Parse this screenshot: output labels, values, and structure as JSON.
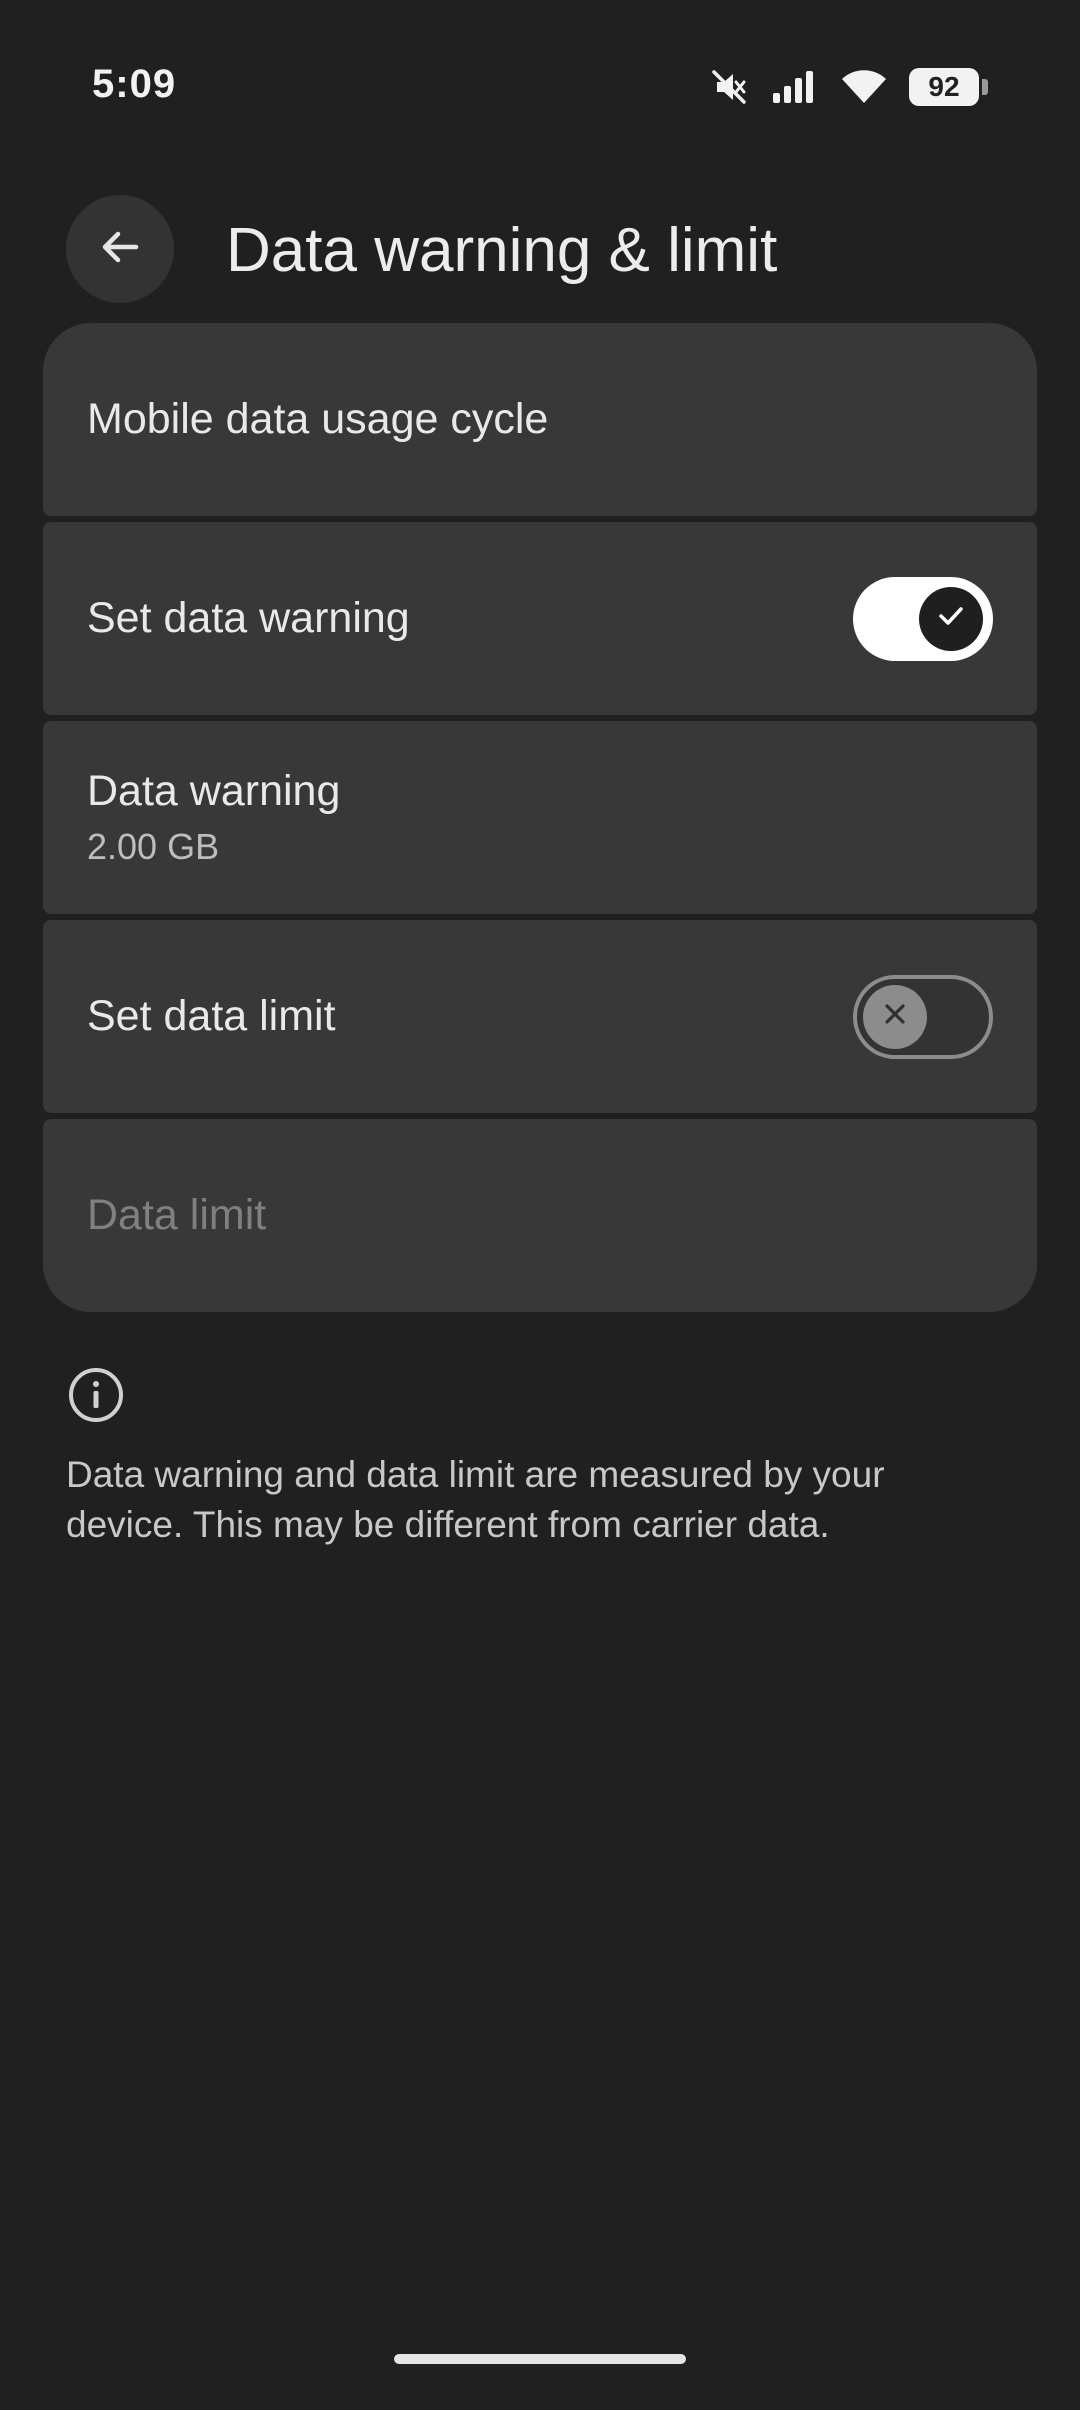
{
  "status_bar": {
    "time": "5:09",
    "battery": "92",
    "icons": [
      "mute-icon",
      "signal-icon",
      "wifi-icon",
      "battery-icon"
    ]
  },
  "app_bar": {
    "back_icon": "arrow-back-icon",
    "title": "Data warning & limit"
  },
  "settings": {
    "usage_cycle": {
      "title": "Mobile data usage cycle"
    },
    "set_warning": {
      "title": "Set data warning",
      "toggle": "on"
    },
    "warning": {
      "title": "Data warning",
      "summary": "2.00 GB"
    },
    "set_limit": {
      "title": "Set data limit",
      "toggle": "off"
    },
    "limit": {
      "title": "Data limit",
      "enabled": false
    }
  },
  "footer": {
    "icon": "info-icon",
    "text": "Data warning and data limit are measured by your device. This may be different from carrier data."
  },
  "colors": {
    "background": "#202020",
    "card": "#383838",
    "text_primary": "#e9e9e9",
    "text_disabled": "#808080",
    "switch_on": "#ffffff",
    "switch_off": "#8c8c8c"
  }
}
